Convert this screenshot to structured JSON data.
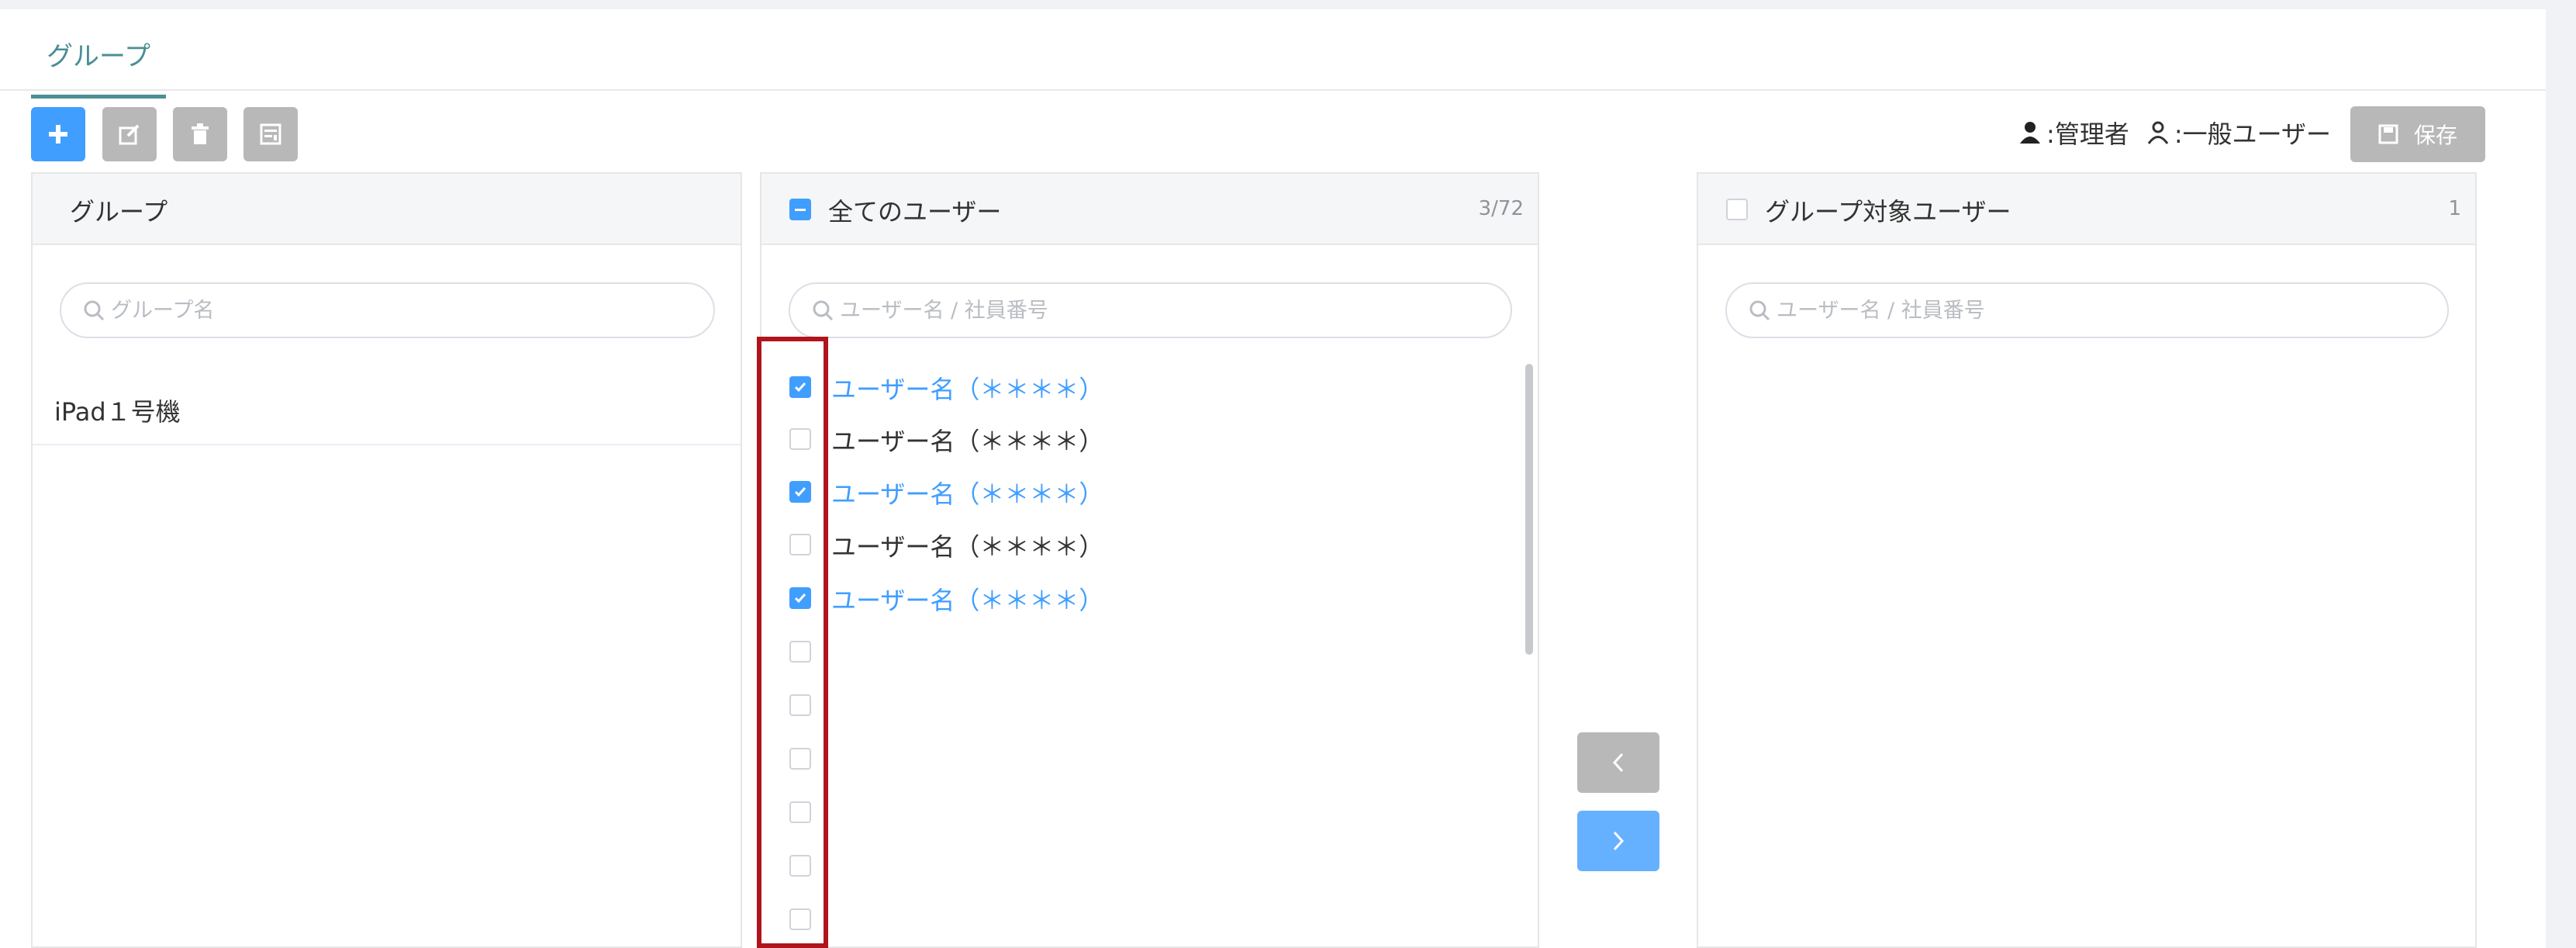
{
  "tab": {
    "label": "グループ"
  },
  "toolbar": {
    "add_icon": "plus-icon",
    "edit_icon": "edit-icon",
    "delete_icon": "trash-icon",
    "save_list_icon": "list-save-icon"
  },
  "legend": {
    "admin_label": ":管理者",
    "general_label": ":一般ユーザー"
  },
  "save_button": {
    "label": "保存"
  },
  "group_panel": {
    "title": "グループ",
    "search_placeholder": "グループ名",
    "items": [
      "iPad１号機"
    ]
  },
  "all_users_panel": {
    "title": "全てのユーザー",
    "count": "3/72",
    "search_placeholder": "ユーザー名 / 社員番号",
    "users": [
      {
        "label": "ユーザー名（＊＊＊＊）",
        "checked": true
      },
      {
        "label": "ユーザー名（＊＊＊＊）",
        "checked": false
      },
      {
        "label": "ユーザー名（＊＊＊＊）",
        "checked": true
      },
      {
        "label": "ユーザー名（＊＊＊＊）",
        "checked": false
      },
      {
        "label": "ユーザー名（＊＊＊＊）",
        "checked": true
      },
      {
        "label": "",
        "checked": false
      },
      {
        "label": "",
        "checked": false
      },
      {
        "label": "",
        "checked": false
      },
      {
        "label": "",
        "checked": false
      },
      {
        "label": "",
        "checked": false
      },
      {
        "label": "",
        "checked": false
      }
    ]
  },
  "target_users_panel": {
    "title": "グループ対象ユーザー",
    "count": "1",
    "search_placeholder": "ユーザー名 / 社員番号"
  },
  "colors": {
    "accent": "#409eff",
    "teal": "#4a8f93",
    "disabled": "#b8b8b8",
    "highlight": "#b0141c"
  }
}
